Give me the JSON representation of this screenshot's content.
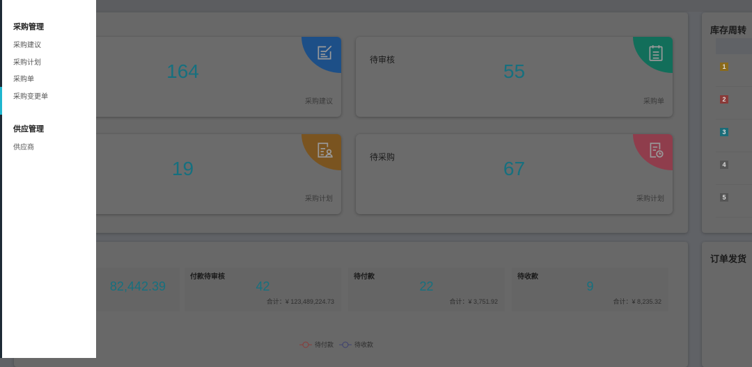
{
  "sidebar": {
    "groups": [
      {
        "title": "采购管理",
        "items": [
          "采购建议",
          "采购计划",
          "采购单",
          "采购变更单"
        ]
      },
      {
        "title": "供应管理",
        "items": [
          "供应商"
        ]
      }
    ]
  },
  "cards": [
    {
      "label": "",
      "value": "164",
      "footer": "采购建议",
      "icon": "edit-icon",
      "color": "#2b6cc4"
    },
    {
      "label": "待审核",
      "value": "55",
      "footer": "采购单",
      "icon": "calendar-list-icon",
      "color": "#17a587"
    },
    {
      "label": "",
      "value": "19",
      "footer": "采购计划",
      "icon": "document-user-icon",
      "color": "#d08c1f"
    },
    {
      "label": "待采购",
      "value": "67",
      "footer": "采购计划",
      "icon": "document-clock-icon",
      "color": "#d9546a"
    }
  ],
  "inventory": {
    "title": "库存周转",
    "ranks": [
      "1",
      "2",
      "3",
      "4",
      "5"
    ],
    "rank_colors": [
      "#e6a817",
      "#d9534f",
      "#17a2b8",
      "#888888",
      "#888888"
    ]
  },
  "payments": {
    "stats": [
      {
        "label": "",
        "value": "82,442.39",
        "total": ""
      },
      {
        "label": "付款待审核",
        "value": "42",
        "total": "合计：¥ 123,489,224.73"
      },
      {
        "label": "待付款",
        "value": "22",
        "total": "合计：¥ 3,751.92"
      },
      {
        "label": "待收款",
        "value": "9",
        "total": "合计：¥ 8,235.32"
      }
    ],
    "legend": [
      {
        "name": "待付款",
        "color": "#d9534f"
      },
      {
        "name": "待收款",
        "color": "#5b5fa8"
      }
    ]
  },
  "shipping": {
    "title": "订单发货"
  }
}
